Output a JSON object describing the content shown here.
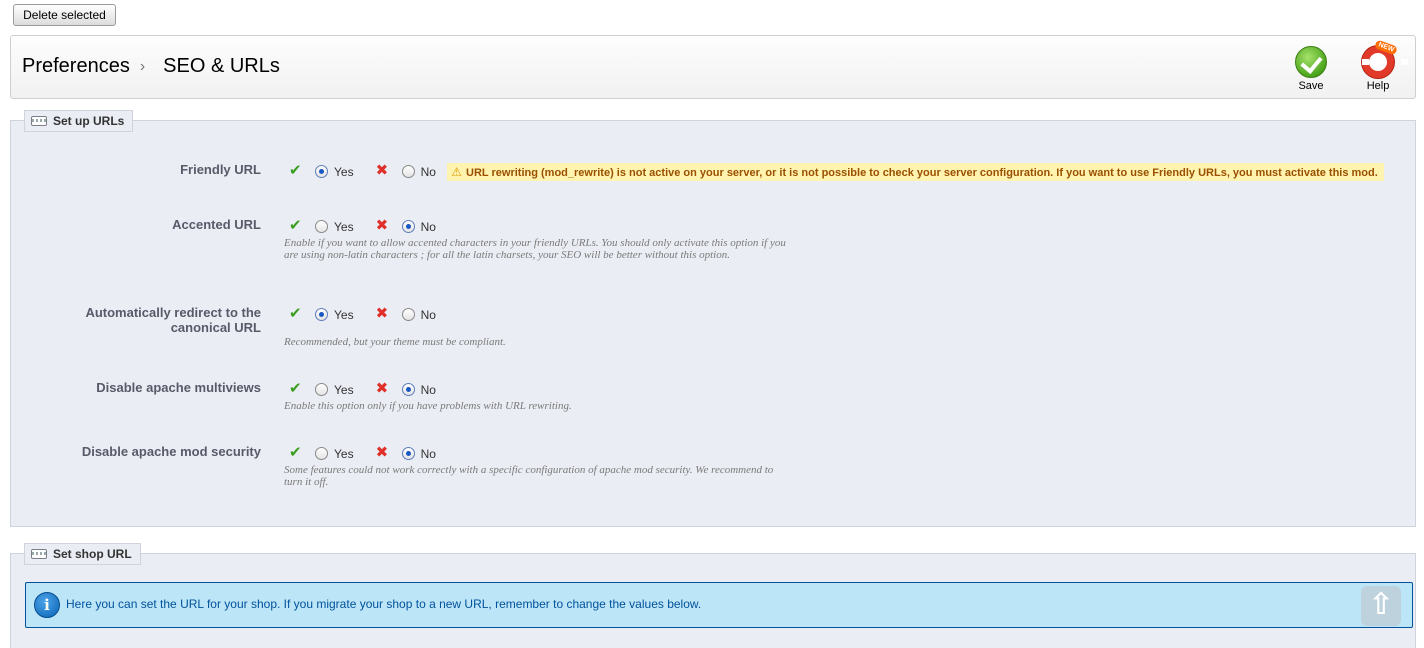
{
  "top": {
    "delete_label": "Delete selected"
  },
  "header": {
    "crumb_parent": "Preferences",
    "crumb_sep": "›",
    "crumb_current": "SEO & URLs",
    "save_label": "Save",
    "help_label": "Help",
    "help_badge": "NEW"
  },
  "setup": {
    "legend": "Set up URLs",
    "yes": "Yes",
    "no": "No",
    "rows": [
      {
        "label": "Friendly URL",
        "selected": "yes",
        "warning": "URL rewriting (mod_rewrite) is not active on your server, or it is not possible to check your server configuration. If you want to use Friendly URLs, you must activate this mod.",
        "hint": ""
      },
      {
        "label": "Accented URL",
        "selected": "no",
        "hint": "Enable if you want to allow accented characters in your friendly URLs. You should only activate this option if you are using non-latin characters ; for all the latin charsets, your SEO will be better without this option."
      },
      {
        "label": "Automatically redirect to the canonical URL",
        "selected": "yes",
        "hint": "Recommended, but your theme must be compliant."
      },
      {
        "label": "Disable apache multiviews",
        "selected": "no",
        "hint": "Enable this option only if you have problems with URL rewriting."
      },
      {
        "label": "Disable apache mod security",
        "selected": "no",
        "hint": "Some features could not work correctly with a specific configuration of apache mod security. We recommend to turn it off."
      }
    ]
  },
  "shop": {
    "legend": "Set shop URL",
    "info": "Here you can set the URL for your shop. If you migrate your shop to a new URL, remember to change the values below."
  },
  "icons": {
    "save": "save-check-icon",
    "help": "lifebuoy-icon",
    "legend": "keyboard-icon",
    "yes": "check-icon",
    "no": "cross-icon",
    "warning": "warning-icon",
    "info": "info-icon",
    "scroll": "arrow-up-icon"
  },
  "colors": {
    "warning_bg": "#fff3b0",
    "info_bg": "#bde5f8",
    "panel_bg": "#ebedf4"
  }
}
